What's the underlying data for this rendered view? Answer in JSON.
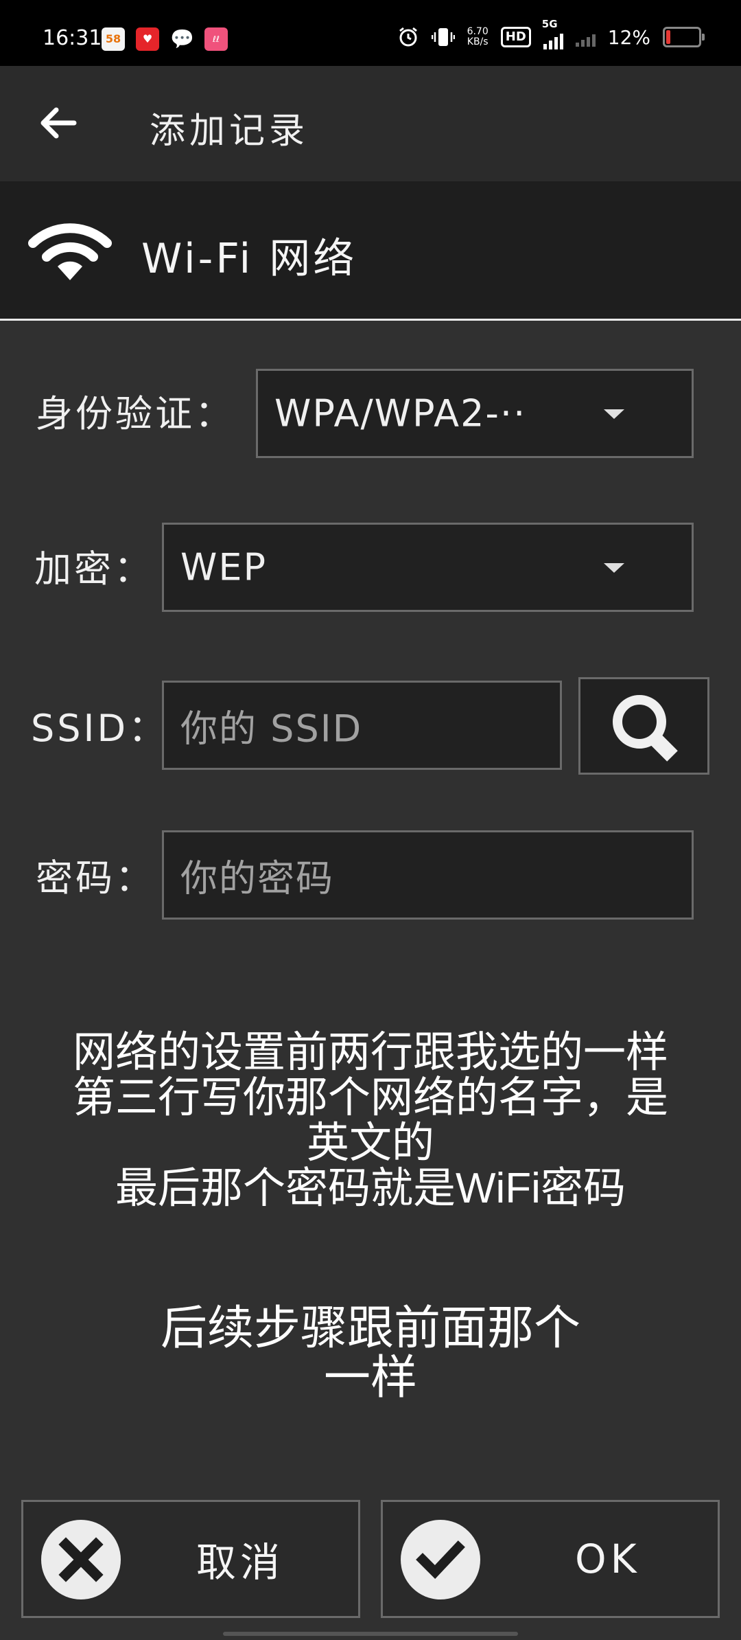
{
  "status_bar": {
    "time": "16:31",
    "net_speed_value": "6.70",
    "net_speed_unit": "KB/s",
    "hd_label": "HD",
    "network_type": "5G",
    "battery_text": "12%",
    "battery_level_percent": 12,
    "app_icons": [
      "58-app-icon",
      "red-app-icon",
      "wechat-icon",
      "pink-app-icon"
    ]
  },
  "app_bar": {
    "back_icon": "arrow-left-icon",
    "title": "添加记录"
  },
  "section": {
    "icon": "wifi-icon",
    "title": "Wi-Fi 网络"
  },
  "form": {
    "auth": {
      "label": "身份验证：",
      "value": "WPA/WPA2-··"
    },
    "encryption": {
      "label": "加密：",
      "value": "WEP"
    },
    "ssid": {
      "label": "SSID：",
      "placeholder": "你的 SSID",
      "search_icon": "search-icon"
    },
    "password": {
      "label": "密码：",
      "placeholder": "你的密码"
    }
  },
  "notes": {
    "block1": [
      "网络的设置前两行跟我选的一样",
      "第三行写你那个网络的名字，是",
      "英文的",
      "最后那个密码就是WiFi密码"
    ],
    "block2": [
      "后续步骤跟前面那个",
      "一样"
    ]
  },
  "buttons": {
    "cancel": {
      "label": "取消",
      "icon": "close-icon"
    },
    "ok": {
      "label": "OK",
      "icon": "check-icon"
    }
  },
  "colors": {
    "background": "#303030",
    "header": "#1e1e1e",
    "field": "#212121",
    "battery_low": "#e53935"
  }
}
